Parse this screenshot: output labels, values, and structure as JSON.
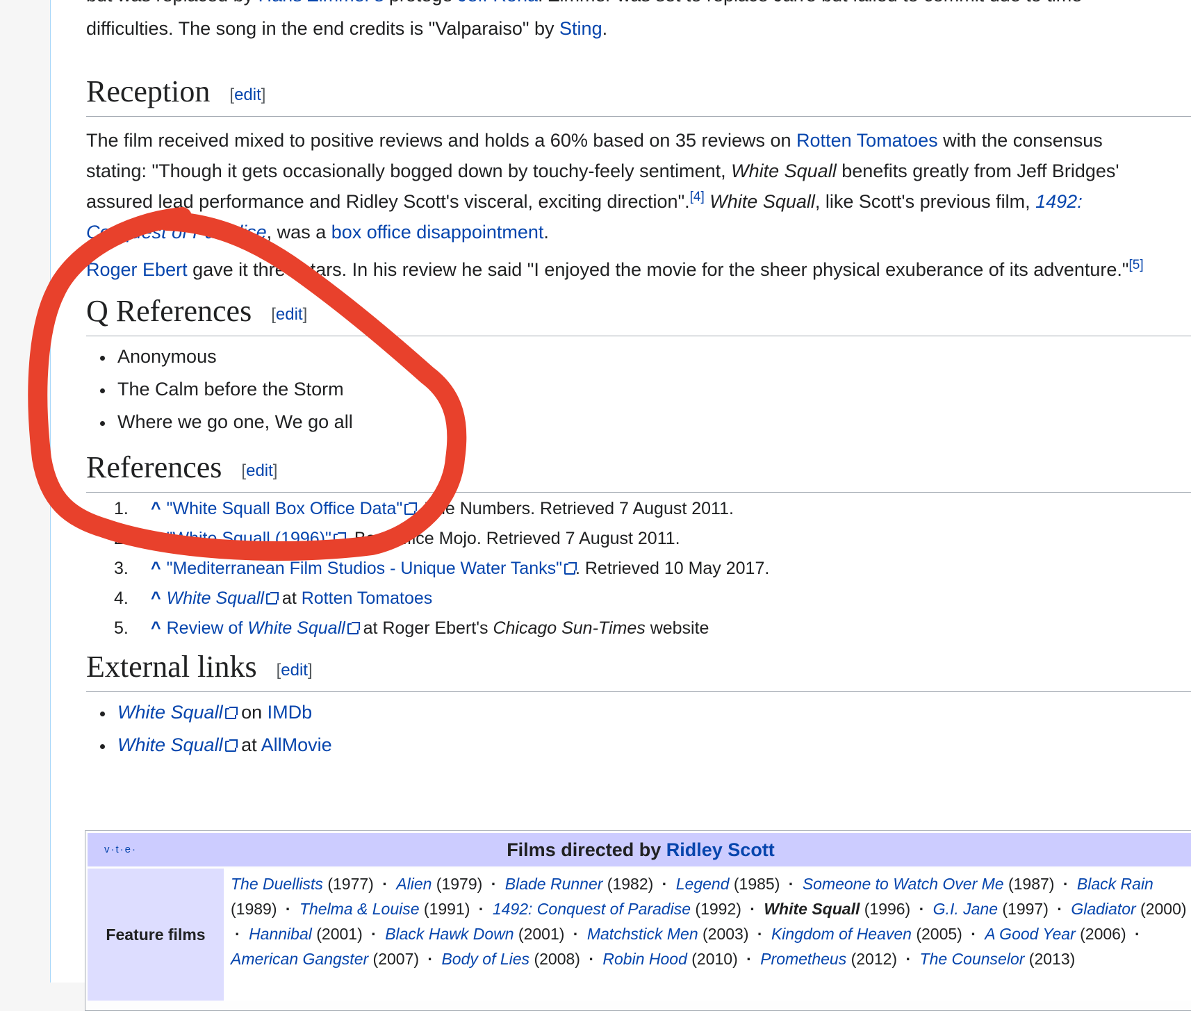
{
  "intro": {
    "line1_pre": "but was replaced by ",
    "line1_link1": "Hans Zimmer's",
    "line1_mid": " protégé ",
    "line1_link2": "Jeff Rona",
    "line1_post": ". Zimmer was set to replace Jarre but failed to commit due to time",
    "line2_pre": "difficulties. The song in the end credits is \"Valparaiso\" by ",
    "line2_link": "Sting",
    "line2_post": "."
  },
  "edit_label": "edit",
  "reception": {
    "heading": "Reception",
    "p1_l1_pre": "The film received mixed to positive reviews and holds a 60% based on 35 reviews on ",
    "p1_l1_link": "Rotten Tomatoes",
    "p1_l1_post": " with the consensus",
    "p1_l2_pre": "stating: \"Though it gets occasionally bogged down by touchy-feely sentiment, ",
    "p1_l2_ital": "White Squall",
    "p1_l2_post": " benefits greatly from Jeff Bridges'",
    "p1_l3_pre": "assured lead performance and Ridley Scott's visceral, exciting direction\".",
    "p1_l3_sup": "[4]",
    "p1_l3_ital": "White Squall",
    "p1_l3_mid": ", like Scott's previous film, ",
    "p1_l3_link": "1492:",
    "p1_l4_link": "Conquest of Paradise",
    "p1_l4_mid": ", was a ",
    "p1_l4_link2": "box office disappointment",
    "p1_l4_post": ".",
    "p2_link": "Roger Ebert",
    "p2_text": " gave it three stars. In his review he said \"I enjoyed the movie for the sheer physical exuberance of its adventure.\"",
    "p2_sup": "[5]"
  },
  "q_references": {
    "heading": "Q References",
    "items": [
      "Anonymous",
      "The Calm before the Storm",
      "Where we go one, We go all"
    ]
  },
  "references": {
    "heading": "References",
    "items": [
      {
        "num": "1.",
        "link": "\"White Squall Box Office Data\"",
        "rest": ". The Numbers. Retrieved 7 August 2011."
      },
      {
        "num": "2.",
        "link": "\"White Squall (1996)\"",
        "rest": ". Box Office Mojo. Retrieved 7 August 2011."
      },
      {
        "num": "3.",
        "link": "\"Mediterranean Film Studios - Unique Water Tanks\"",
        "rest": ". Retrieved 10 May 2017."
      },
      {
        "num": "4.",
        "link_ital": "White Squall",
        "mid": " at ",
        "link2": "Rotten Tomatoes"
      },
      {
        "num": "5.",
        "link_pre": "Review of ",
        "link_ital": "White Squall",
        "mid": " at Roger Ebert's ",
        "ital": "Chicago Sun-Times",
        "post": " website"
      }
    ],
    "caret": "^"
  },
  "external_links": {
    "heading": "External links",
    "items": [
      {
        "ital": "White Squall",
        "mid": " on ",
        "link": "IMDb"
      },
      {
        "ital": "White Squall",
        "mid": " at ",
        "link": "AllMovie"
      }
    ]
  },
  "navbox": {
    "vte": "v·t·e·",
    "title_pre": "Films directed by ",
    "title_link": "Ridley Scott",
    "group": "Feature films",
    "films": [
      {
        "t": "The Duellists",
        "y": "(1977)"
      },
      {
        "t": "Alien",
        "y": "(1979)"
      },
      {
        "t": "Blade Runner",
        "y": "(1982)"
      },
      {
        "t": "Legend",
        "y": "(1985)"
      },
      {
        "t": "Someone to Watch Over Me",
        "y": "(1987)"
      },
      {
        "t": "Black Rain",
        "y": "(1989)"
      },
      {
        "t": "Thelma & Louise",
        "y": "(1991)"
      },
      {
        "t": "1492: Conquest of Paradise",
        "y": "(1992)"
      },
      {
        "t": "White Squall",
        "y": "(1996)",
        "self": true
      },
      {
        "t": "G.I. Jane",
        "y": "(1997)"
      },
      {
        "t": "Gladiator",
        "y": "(2000)"
      },
      {
        "t": "Hannibal",
        "y": "(2001)"
      },
      {
        "t": "Black Hawk Down",
        "y": "(2001)"
      },
      {
        "t": "Matchstick Men",
        "y": "(2003)"
      },
      {
        "t": "Kingdom of Heaven",
        "y": "(2005)"
      },
      {
        "t": "A Good Year",
        "y": "(2006)"
      },
      {
        "t": "American Gangster",
        "y": "(2007)"
      },
      {
        "t": "Body of Lies",
        "y": "(2008)"
      },
      {
        "t": "Robin Hood",
        "y": "(2010)"
      },
      {
        "t": "Prometheus",
        "y": "(2012)"
      },
      {
        "t": "The Counselor",
        "y": "(2013)"
      }
    ]
  },
  "colors": {
    "link": "#0645ad",
    "annotation": "#e8412c",
    "navhead": "#ccccff",
    "navgroup": "#ddddff"
  }
}
